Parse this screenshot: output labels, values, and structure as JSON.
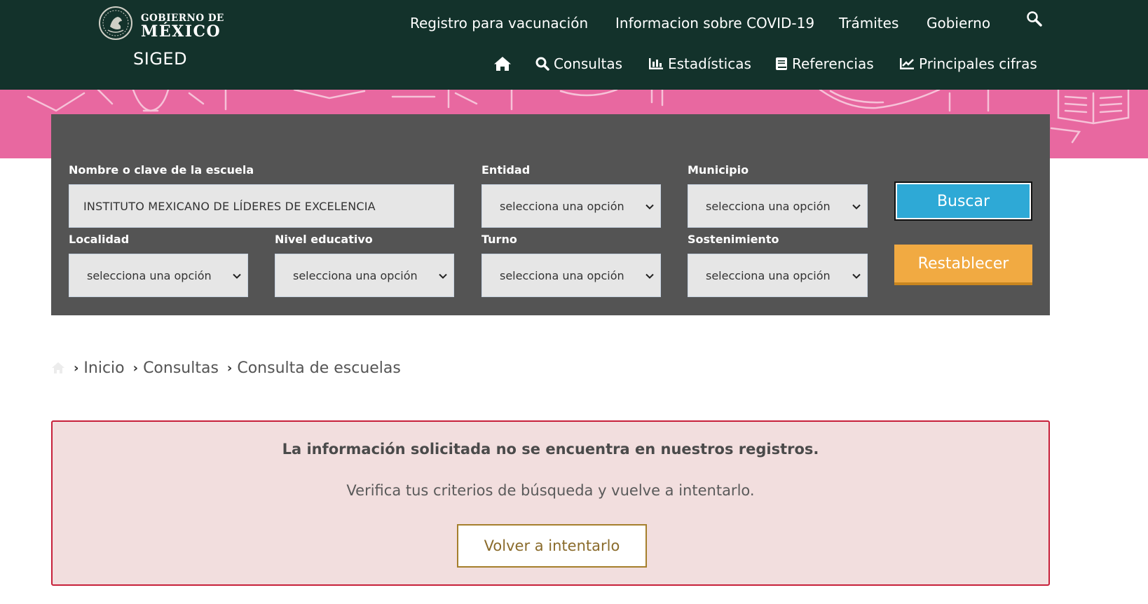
{
  "header": {
    "logo": {
      "line1": "GOBIERNO DE",
      "line2": "MÉXICO"
    },
    "site_name": "SIGED",
    "top_links": [
      {
        "label": "Registro para vacunación"
      },
      {
        "label": "Informacion sobre COVID-19"
      },
      {
        "label": "Trámites"
      },
      {
        "label": "Gobierno"
      }
    ],
    "search_icon": "search-icon",
    "sub_nav": [
      {
        "label": "Consultas",
        "icon": "search-icon"
      },
      {
        "label": "Estadísticas",
        "icon": "bar-chart-icon"
      },
      {
        "label": "Referencias",
        "icon": "book-icon"
      },
      {
        "label": "Principales cifras",
        "icon": "line-chart-icon"
      }
    ],
    "colors": {
      "bar": "#13322b",
      "banner": "#e868a0"
    }
  },
  "search_form": {
    "school": {
      "label": "Nombre o clave de la escuela",
      "value": "INSTITUTO MEXICANO DE LÍDERES DE EXCELENCIA"
    },
    "entidad": {
      "label": "Entidad",
      "value": "selecciona una opción"
    },
    "municipio": {
      "label": "Municipio",
      "value": "selecciona una opción"
    },
    "localidad": {
      "label": "Localidad",
      "value": "selecciona una opción"
    },
    "nivel": {
      "label": "Nivel educativo",
      "value": "selecciona una opción"
    },
    "turno": {
      "label": "Turno",
      "value": "selecciona una opción"
    },
    "sostenimiento": {
      "label": "Sostenimiento",
      "value": "selecciona una opción"
    },
    "search_button": "Buscar",
    "reset_button": "Restablecer",
    "colors": {
      "panel": "#545454",
      "search_button": "#2ea9d6",
      "reset_button": "#f1aa42"
    }
  },
  "breadcrumb": {
    "items": [
      "Inicio",
      "Consultas",
      "Consulta de escuelas"
    ]
  },
  "alert": {
    "title": "La información solicitada no se encuentra en nuestros registros.",
    "message": "Verifica tus criterios de búsqueda y vuelve a intentarlo.",
    "button": "Volver a intentarlo",
    "colors": {
      "background": "#f2dede",
      "border": "#c7203a"
    }
  }
}
